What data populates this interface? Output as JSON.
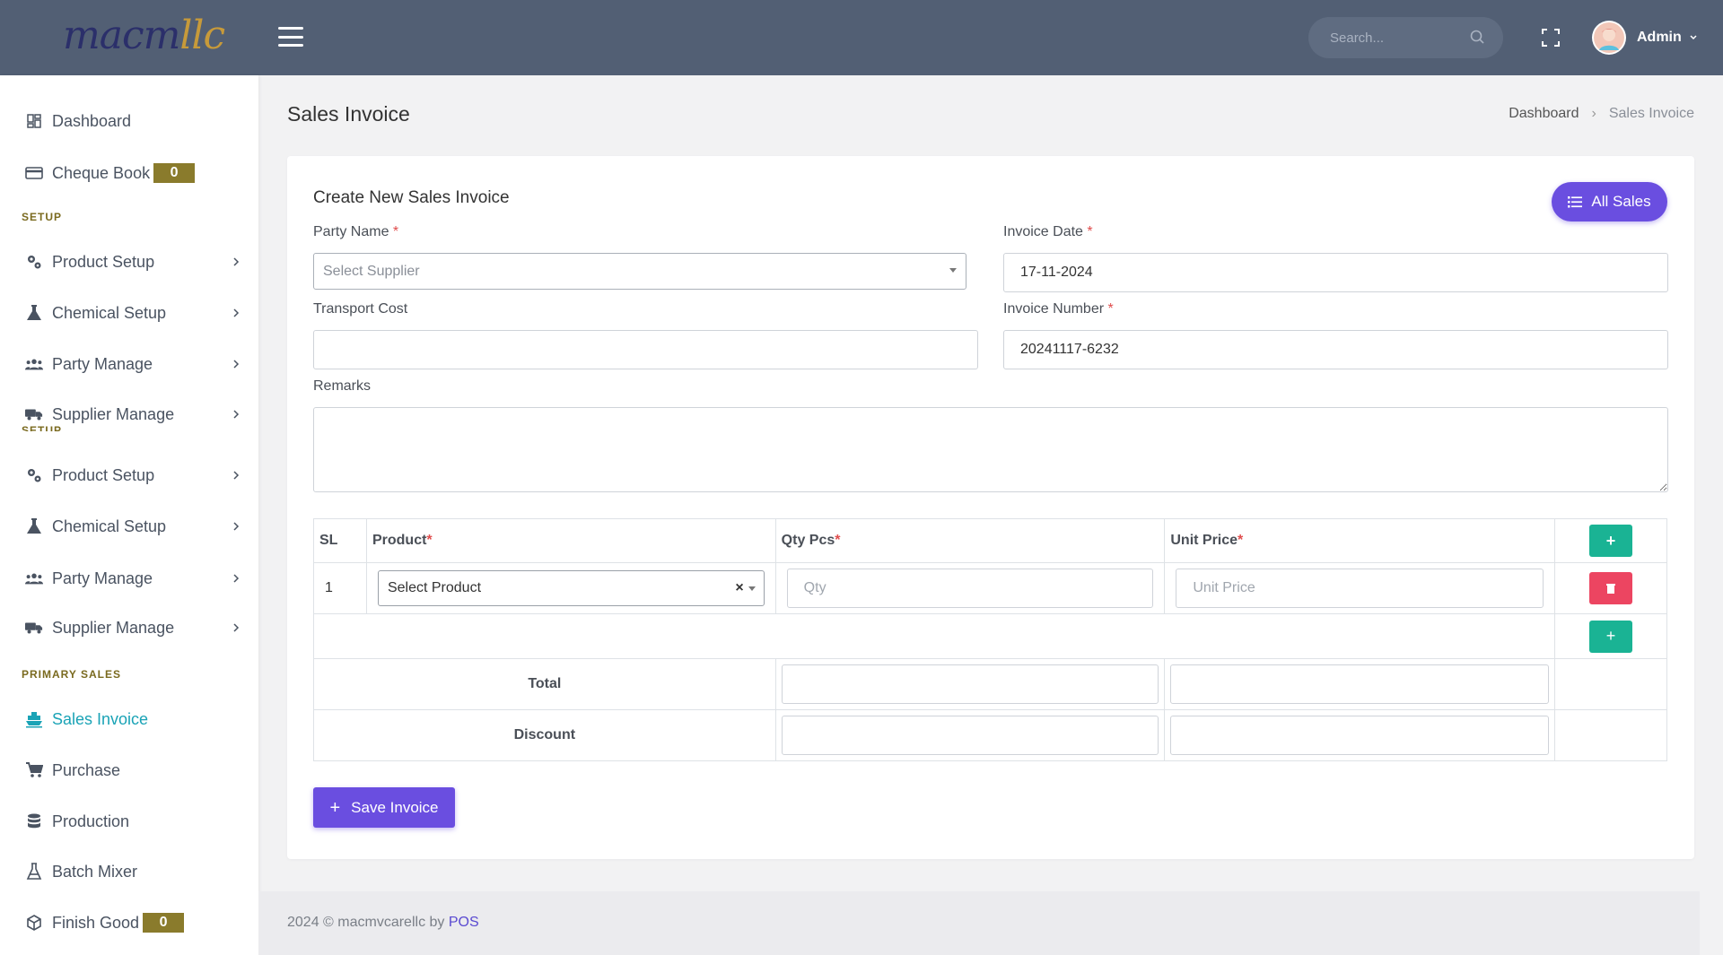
{
  "topbar": {
    "logo_main": "macm",
    "logo_accent": "llc",
    "search_placeholder": "Search...",
    "user_name": "Admin"
  },
  "sidebar": {
    "dashboard": "Dashboard",
    "cheque_book": "Cheque Book",
    "cheque_book_count": "0",
    "setup_heading_1": "SETUP",
    "product_setup_1": "Product Setup",
    "chemical_setup_1": "Chemical Setup",
    "party_manage_1": "Party Manage",
    "supplier_manage_1": "Supplier Manage",
    "setup_heading_2": "SETUP",
    "product_setup_2": "Product Setup",
    "chemical_setup_2": "Chemical Setup",
    "party_manage_2": "Party Manage",
    "supplier_manage_2": "Supplier Manage",
    "primary_sales_heading": "PRIMARY SALES",
    "sales_invoice": "Sales Invoice",
    "purchase": "Purchase",
    "production": "Production",
    "batch_mixer": "Batch Mixer",
    "finish_good": "Finish Good",
    "finish_good_count": "0"
  },
  "page": {
    "title": "Sales Invoice",
    "breadcrumb_home": "Dashboard",
    "breadcrumb_current": "Sales Invoice"
  },
  "form": {
    "card_title": "Create New Sales Invoice",
    "all_sales_label": "All Sales",
    "party_name_label": "Party Name",
    "party_name_placeholder": "Select Supplier",
    "invoice_date_label": "Invoice Date",
    "invoice_date_value": "17-11-2024",
    "transport_cost_label": "Transport Cost",
    "transport_cost_value": "",
    "invoice_number_label": "Invoice Number",
    "invoice_number_value": "20241117-6232",
    "remarks_label": "Remarks",
    "required_mark": "*"
  },
  "table": {
    "col_sl": "SL",
    "col_product": "Product",
    "col_qty": "Qty Pcs",
    "col_unit_price": "Unit Price",
    "row_sl": "1",
    "product_selected": "Select Product",
    "clear_symbol": "×",
    "qty_placeholder": "Qty",
    "unit_price_placeholder": "Unit Price",
    "total_label": "Total",
    "discount_label": "Discount",
    "plus_symbol": "+"
  },
  "save_label": "Save Invoice",
  "footer": {
    "text": "2024 © macmvcarellc by ",
    "brand": "POS"
  }
}
